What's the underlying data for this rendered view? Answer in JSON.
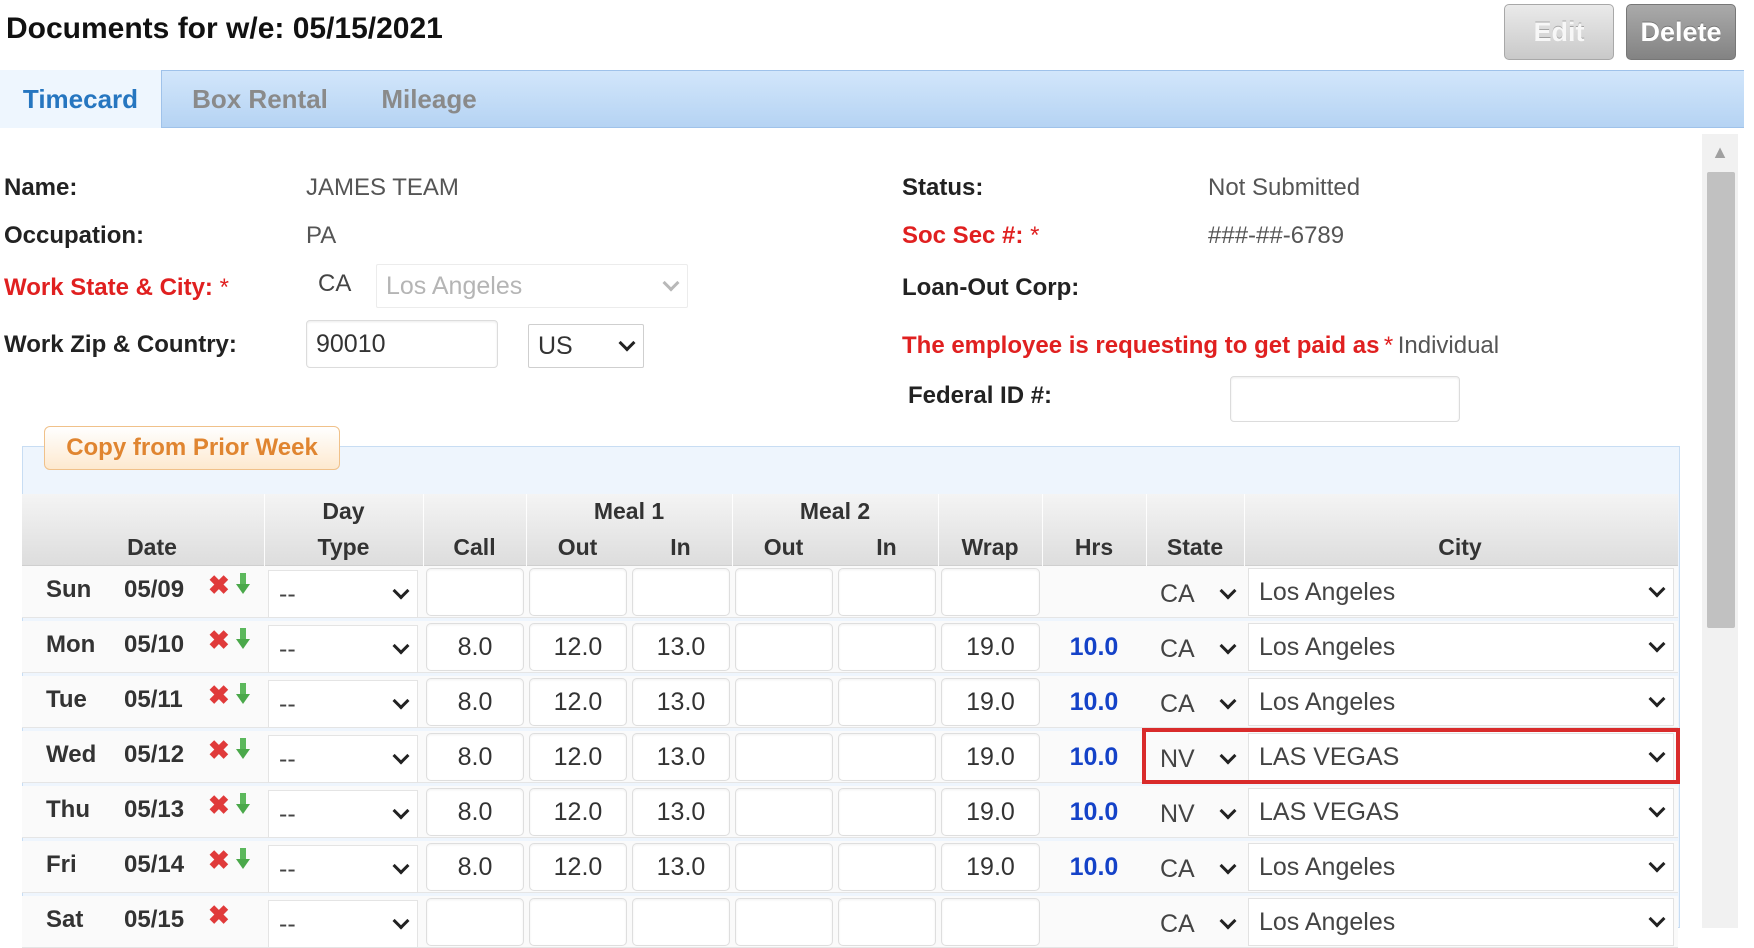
{
  "header": {
    "title": "Documents for w/e: 05/15/2021",
    "edit_label": "Edit",
    "delete_label": "Delete"
  },
  "tabs": [
    {
      "label": "Timecard",
      "active": true
    },
    {
      "label": "Box Rental",
      "active": false
    },
    {
      "label": "Mileage",
      "active": false
    }
  ],
  "employee": {
    "name_label": "Name:",
    "name_value": "JAMES TEAM",
    "occupation_label": "Occupation:",
    "occupation_value": "PA",
    "work_state_city_label": "Work State & City:",
    "work_state_value": "CA",
    "work_city_value": "Los Angeles",
    "work_zip_country_label": "Work Zip & Country:",
    "work_zip_value": "90010",
    "work_country_value": "US",
    "status_label": "Status:",
    "status_value": "Not Submitted",
    "ssn_label": "Soc Sec #:",
    "ssn_value": "###-##-6789",
    "loanout_label": "Loan-Out Corp:",
    "paid_as_label": "The employee is requesting to get paid as",
    "paid_as_value": "Individual",
    "federal_id_label": "Federal ID #:",
    "federal_id_value": "",
    "required_mark": "*"
  },
  "copy_button_label": "Copy from Prior Week",
  "table": {
    "group_headers": {
      "day": "Day",
      "meal1": "Meal 1",
      "meal2": "Meal 2"
    },
    "columns": {
      "date": "Date",
      "type": "Type",
      "call": "Call",
      "meal1_out": "Out",
      "meal1_in": "In",
      "meal2_out": "Out",
      "meal2_in": "In",
      "wrap": "Wrap",
      "hrs": "Hrs",
      "state": "State",
      "city": "City"
    },
    "rows": [
      {
        "day": "Sun",
        "date": "05/09",
        "type": "--",
        "call": "",
        "m1_out": "",
        "m1_in": "",
        "m2_out": "",
        "m2_in": "",
        "wrap": "",
        "hrs": "",
        "state": "CA",
        "city": "Los Angeles"
      },
      {
        "day": "Mon",
        "date": "05/10",
        "type": "--",
        "call": "8.0",
        "m1_out": "12.0",
        "m1_in": "13.0",
        "m2_out": "",
        "m2_in": "",
        "wrap": "19.0",
        "hrs": "10.0",
        "state": "CA",
        "city": "Los Angeles"
      },
      {
        "day": "Tue",
        "date": "05/11",
        "type": "--",
        "call": "8.0",
        "m1_out": "12.0",
        "m1_in": "13.0",
        "m2_out": "",
        "m2_in": "",
        "wrap": "19.0",
        "hrs": "10.0",
        "state": "CA",
        "city": "Los Angeles"
      },
      {
        "day": "Wed",
        "date": "05/12",
        "type": "--",
        "call": "8.0",
        "m1_out": "12.0",
        "m1_in": "13.0",
        "m2_out": "",
        "m2_in": "",
        "wrap": "19.0",
        "hrs": "10.0",
        "state": "NV",
        "city": "LAS VEGAS"
      },
      {
        "day": "Thu",
        "date": "05/13",
        "type": "--",
        "call": "8.0",
        "m1_out": "12.0",
        "m1_in": "13.0",
        "m2_out": "",
        "m2_in": "",
        "wrap": "19.0",
        "hrs": "10.0",
        "state": "NV",
        "city": "LAS VEGAS"
      },
      {
        "day": "Fri",
        "date": "05/14",
        "type": "--",
        "call": "8.0",
        "m1_out": "12.0",
        "m1_in": "13.0",
        "m2_out": "",
        "m2_in": "",
        "wrap": "19.0",
        "hrs": "10.0",
        "state": "CA",
        "city": "Los Angeles"
      },
      {
        "day": "Sat",
        "date": "05/15",
        "type": "--",
        "call": "",
        "m1_out": "",
        "m1_in": "",
        "m2_out": "",
        "m2_in": "",
        "wrap": "",
        "hrs": "",
        "state": "CA",
        "city": "Los Angeles"
      }
    ]
  },
  "icons": {
    "delete_row": "red-x-icon",
    "copy_down": "green-down-arrow-icon",
    "dropdown": "chevron-down-icon"
  },
  "colors": {
    "required_red": "#e02020",
    "hours_blue": "#1442c8",
    "tab_active_blue": "#2676c0",
    "copy_orange": "#e08530",
    "highlight_red": "#d92b2b"
  }
}
